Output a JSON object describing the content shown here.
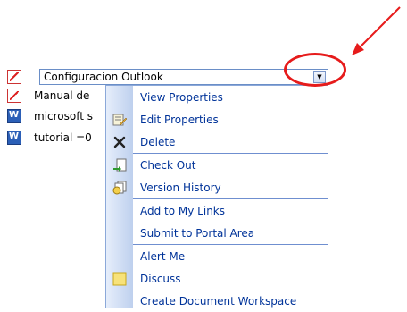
{
  "files": [
    {
      "type": "pdf",
      "name": "Configuracion Outlook"
    },
    {
      "type": "pdf",
      "name": "Manual de"
    },
    {
      "type": "doc",
      "name": "microsoft s"
    },
    {
      "type": "doc",
      "name": "tutorial =0"
    }
  ],
  "dropdown_arrow": "▼",
  "menu": {
    "items": [
      {
        "label": "View Properties",
        "icon": "none"
      },
      {
        "label": "Edit Properties",
        "icon": "edit-properties-icon"
      },
      {
        "label": "Delete",
        "icon": "delete-icon"
      },
      {
        "label": "Check Out",
        "icon": "check-out-icon"
      },
      {
        "label": "Version History",
        "icon": "version-history-icon"
      },
      {
        "label": "Add to My Links",
        "icon": "none"
      },
      {
        "label": "Submit to Portal Area",
        "icon": "none"
      },
      {
        "label": "Alert Me",
        "icon": "none"
      },
      {
        "label": "Discuss",
        "icon": "discuss-icon"
      },
      {
        "label": "Create Document Workspace",
        "icon": "none"
      }
    ]
  },
  "colors": {
    "menu_text": "#003399",
    "menu_border": "#8ba8d9",
    "annotation_red": "#e61b1b"
  }
}
